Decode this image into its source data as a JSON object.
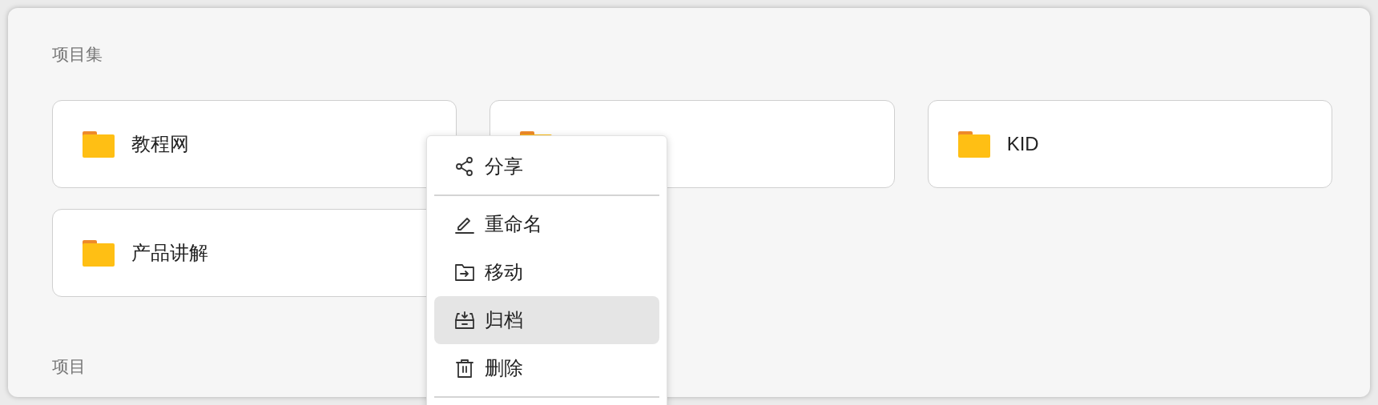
{
  "sections": [
    {
      "title": "项目集",
      "cards": [
        {
          "kind": "folder",
          "name": "教程网"
        },
        {
          "kind": "folder"
        },
        {
          "kind": "folder",
          "name": "KID"
        },
        {
          "kind": "folder",
          "name": "产品讲解"
        }
      ]
    },
    {
      "title": "项目"
    }
  ],
  "context_menu": {
    "items": [
      {
        "label": "分享",
        "selected": false,
        "divider_after": true
      },
      {
        "label": "重命名",
        "selected": false,
        "divider_after": false
      },
      {
        "label": "移动",
        "selected": false,
        "divider_after": false
      },
      {
        "label": "归档",
        "selected": true,
        "divider_after": false
      },
      {
        "label": "删除",
        "selected": false,
        "divider_after": true
      }
    ]
  }
}
